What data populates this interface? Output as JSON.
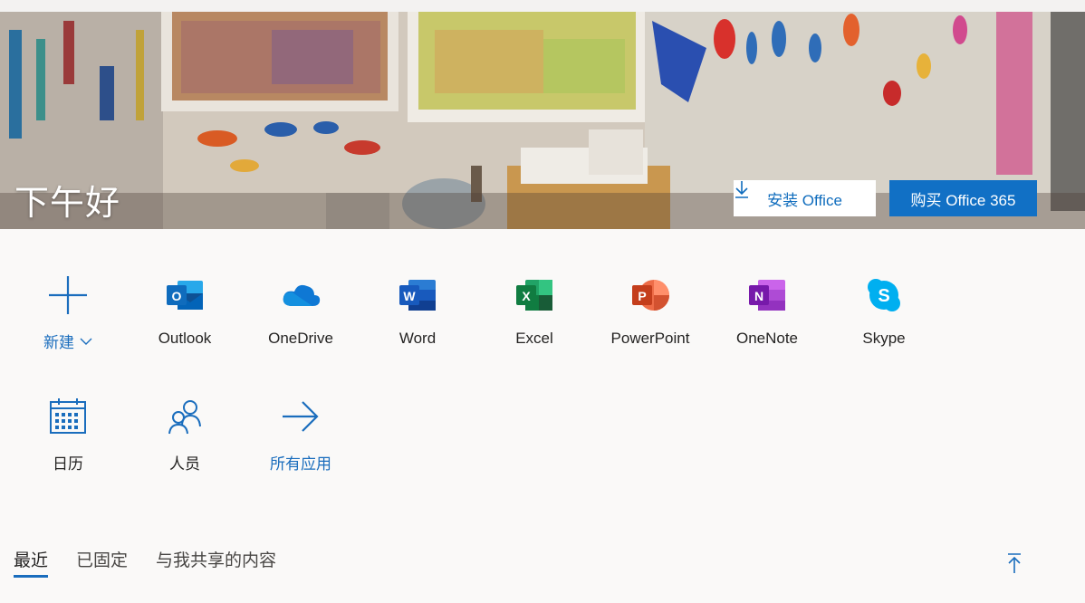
{
  "hero": {
    "greeting": "下午好",
    "install_label": "安装 Office",
    "buy_label": "购买 Office 365"
  },
  "apps": [
    {
      "label": "新建",
      "icon": "plus-icon"
    },
    {
      "label": "Outlook",
      "icon": "outlook-icon",
      "color": "#0f6cbd"
    },
    {
      "label": "OneDrive",
      "icon": "onedrive-icon",
      "color": "#0f78d4"
    },
    {
      "label": "Word",
      "icon": "word-icon",
      "color": "#185abd"
    },
    {
      "label": "Excel",
      "icon": "excel-icon",
      "color": "#107c41"
    },
    {
      "label": "PowerPoint",
      "icon": "powerpoint-icon",
      "color": "#c43e1c"
    },
    {
      "label": "OneNote",
      "icon": "onenote-icon",
      "color": "#7719aa"
    },
    {
      "label": "Skype",
      "icon": "skype-icon",
      "color": "#00aff0"
    },
    {
      "label": "日历",
      "icon": "calendar-icon"
    },
    {
      "label": "人员",
      "icon": "people-icon"
    },
    {
      "label": "所有应用",
      "icon": "arrow-right-icon"
    }
  ],
  "tabs": [
    {
      "label": "最近",
      "active": true
    },
    {
      "label": "已固定",
      "active": false
    },
    {
      "label": "与我共享的内容",
      "active": false
    }
  ],
  "colors": {
    "accent": "#1a6dbd",
    "buy_button": "#1170c5"
  }
}
